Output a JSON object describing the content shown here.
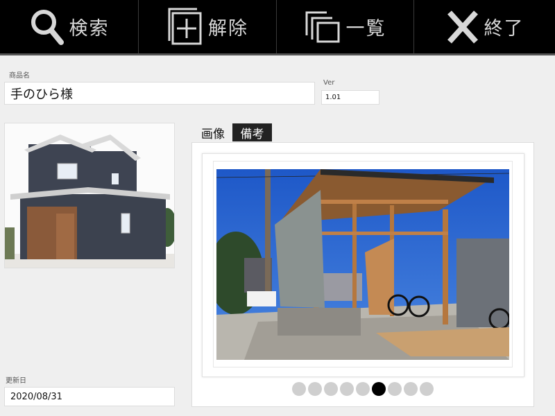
{
  "toolbar": {
    "search_label": "検索",
    "clear_label": "解除",
    "list_label": "一覧",
    "exit_label": "終了"
  },
  "form": {
    "product_name_label": "商品名",
    "product_name_value": "手のひら様",
    "version_label": "Ver",
    "version_value": "1.01",
    "updated_label": "更新日",
    "updated_value": "2020/08/31"
  },
  "tabs": {
    "image_label": "画像",
    "notes_label": "備考",
    "active": "notes"
  },
  "carousel": {
    "total_slides": 9,
    "active_index": 5
  },
  "colors": {
    "toolbar_bg": "#000000",
    "toolbar_text": "#d8d8d8",
    "page_bg": "#efefef",
    "active_tab_bg": "#222222",
    "dot_inactive": "#cfcfcf",
    "dot_active": "#000000"
  },
  "icons": {
    "search": "magnifier-icon",
    "clear": "add-square-icon",
    "list": "copy-stack-icon",
    "exit": "close-x-icon"
  }
}
